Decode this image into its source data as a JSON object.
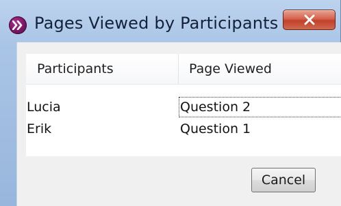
{
  "window": {
    "title": "Pages Viewed by Participants",
    "icon": "app-icon",
    "close_label": "x"
  },
  "table": {
    "columns": [
      "Participants",
      "Page Viewed"
    ],
    "rows": [
      {
        "participant": "Lucia",
        "page": "Question 2"
      },
      {
        "participant": "Erik",
        "page": "Question 1"
      }
    ]
  },
  "buttons": {
    "cancel_label": "Cancel"
  },
  "colors": {
    "title_bar": "#bcd3ee",
    "close_button": "#c1402b",
    "app_icon": "#7a1666"
  }
}
